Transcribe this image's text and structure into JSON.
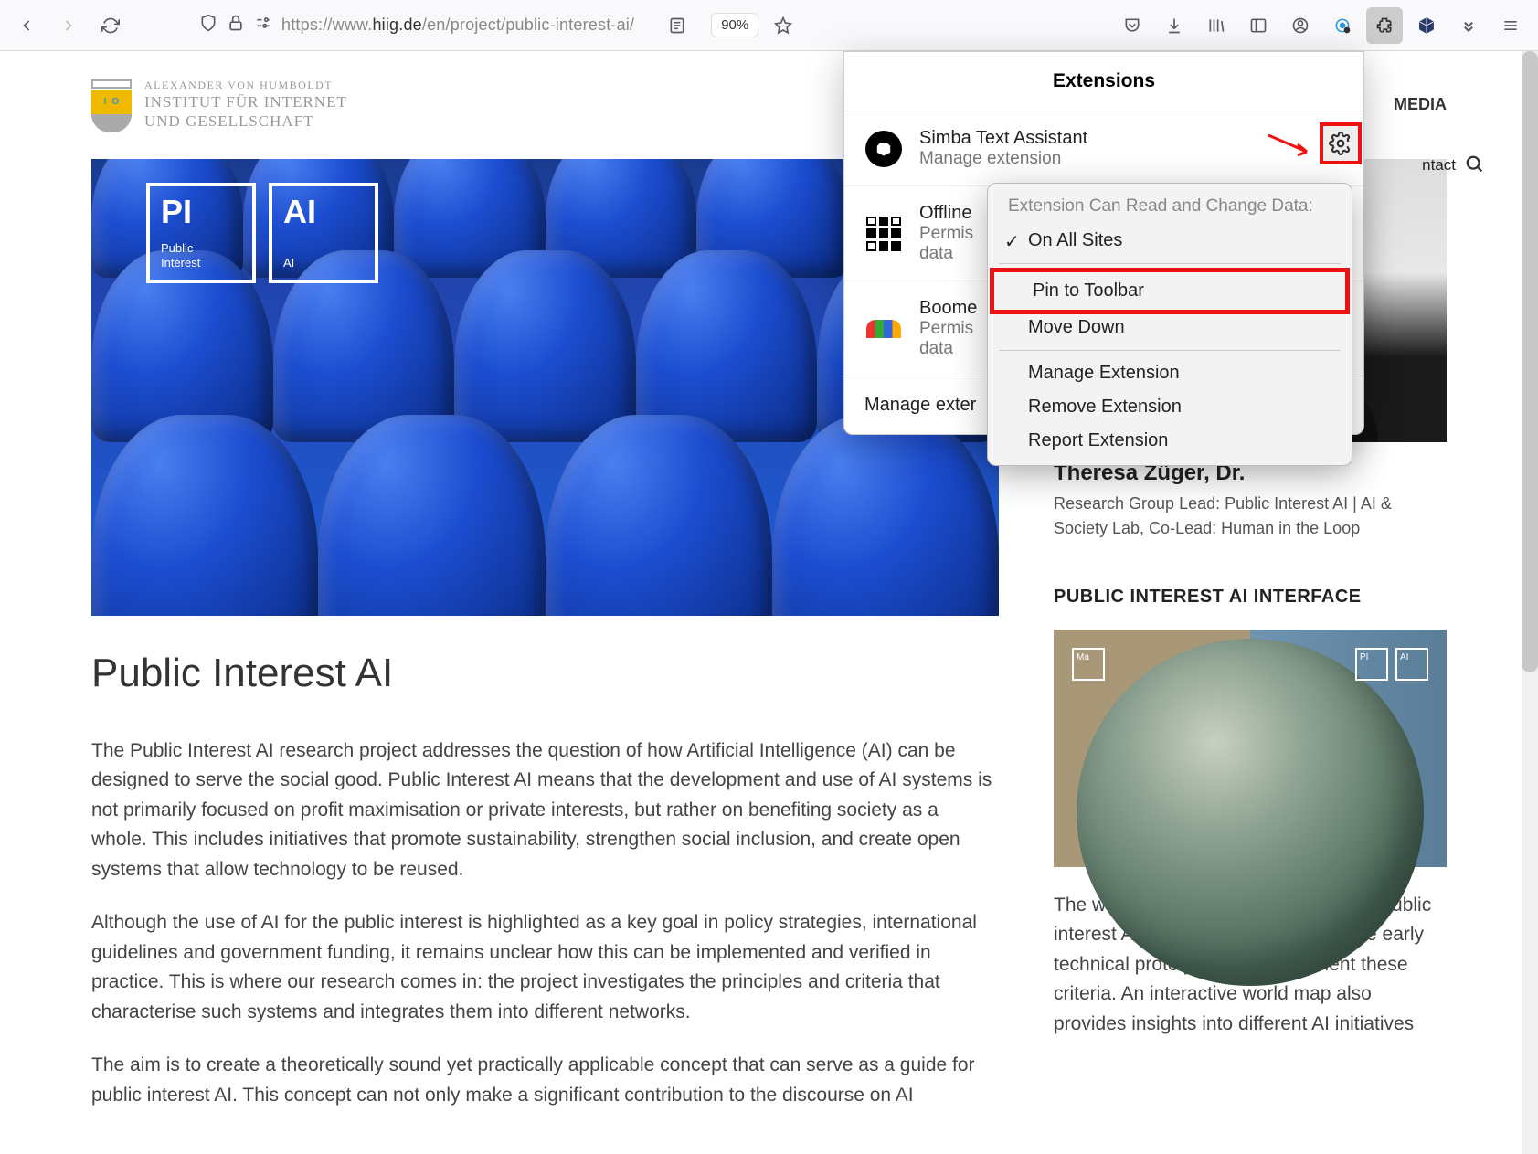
{
  "browser": {
    "url_prefix": "https://www.",
    "url_domain": "hiig.de",
    "url_suffix": "/en/project/public-interest-ai/",
    "zoom": "90%"
  },
  "site": {
    "logo_line1": "ALEXANDER VON HUMBOLDT",
    "logo_line2": "INSTITUT FÜR INTERNET",
    "logo_line3": "UND GESELLSCHAFT",
    "nav_media": "MEDIA",
    "nav_contact": "ntact",
    "hero_badge1_big": "PI",
    "hero_badge1_small1": "Public",
    "hero_badge1_small2": "Interest",
    "hero_badge2_big": "AI",
    "hero_badge2_small": "AI",
    "title": "Public Interest AI",
    "para1": "The Public Interest AI research project addresses the question of how Artificial Intelligence (AI) can be designed to serve the social good. Public Interest AI means that the development and use of AI systems is not primarily focused on profit maximisation or private interests, but rather on benefiting society as a whole. This includes initiatives that promote sustainability, strengthen social inclusion, and create open systems that allow technology to be reused.",
    "para2": "Although the use of AI for the public interest is highlighted as a key goal in policy strategies, international guidelines and government funding, it remains unclear how this can be implemented and verified in practice. This is where our  research comes in: the project investigates the principles and criteria that characterise such systems and integrates them into different networks.",
    "para3": "The aim is to create a theoretically sound yet practically applicable concept that can serve as a guide for public interest AI. This concept can not only make a significant contribution to the discourse on AI"
  },
  "sidebar": {
    "person_name": "Theresa Züger, Dr.",
    "person_role": "Research Group Lead: Public Interest AI | AI & Society Lab, Co-Lead: Human in the Loop",
    "section_title": "PUBLIC INTEREST AI INTERFACE",
    "iface_text": "The website presents the principles of public interest AI and allows users to explore early technical prototypes that implement these criteria. An interactive world map also provides insights into different AI initiatives"
  },
  "extensions": {
    "title": "Extensions",
    "items": [
      {
        "name": "Simba Text Assistant",
        "sub": "Manage extension"
      },
      {
        "name": "Offline",
        "sub1": "Permis",
        "sub2": "data"
      },
      {
        "name": "Boome",
        "sub1": "Permis",
        "sub2": "data"
      }
    ],
    "manage_label_partial": "Manage exter",
    "ctx_header": "Extension Can Read and Change Data:",
    "ctx_on_all": "On All Sites",
    "ctx_pin": "Pin to Toolbar",
    "ctx_move_down": "Move Down",
    "ctx_manage": "Manage Extension",
    "ctx_remove": "Remove Extension",
    "ctx_report": "Report Extension"
  }
}
